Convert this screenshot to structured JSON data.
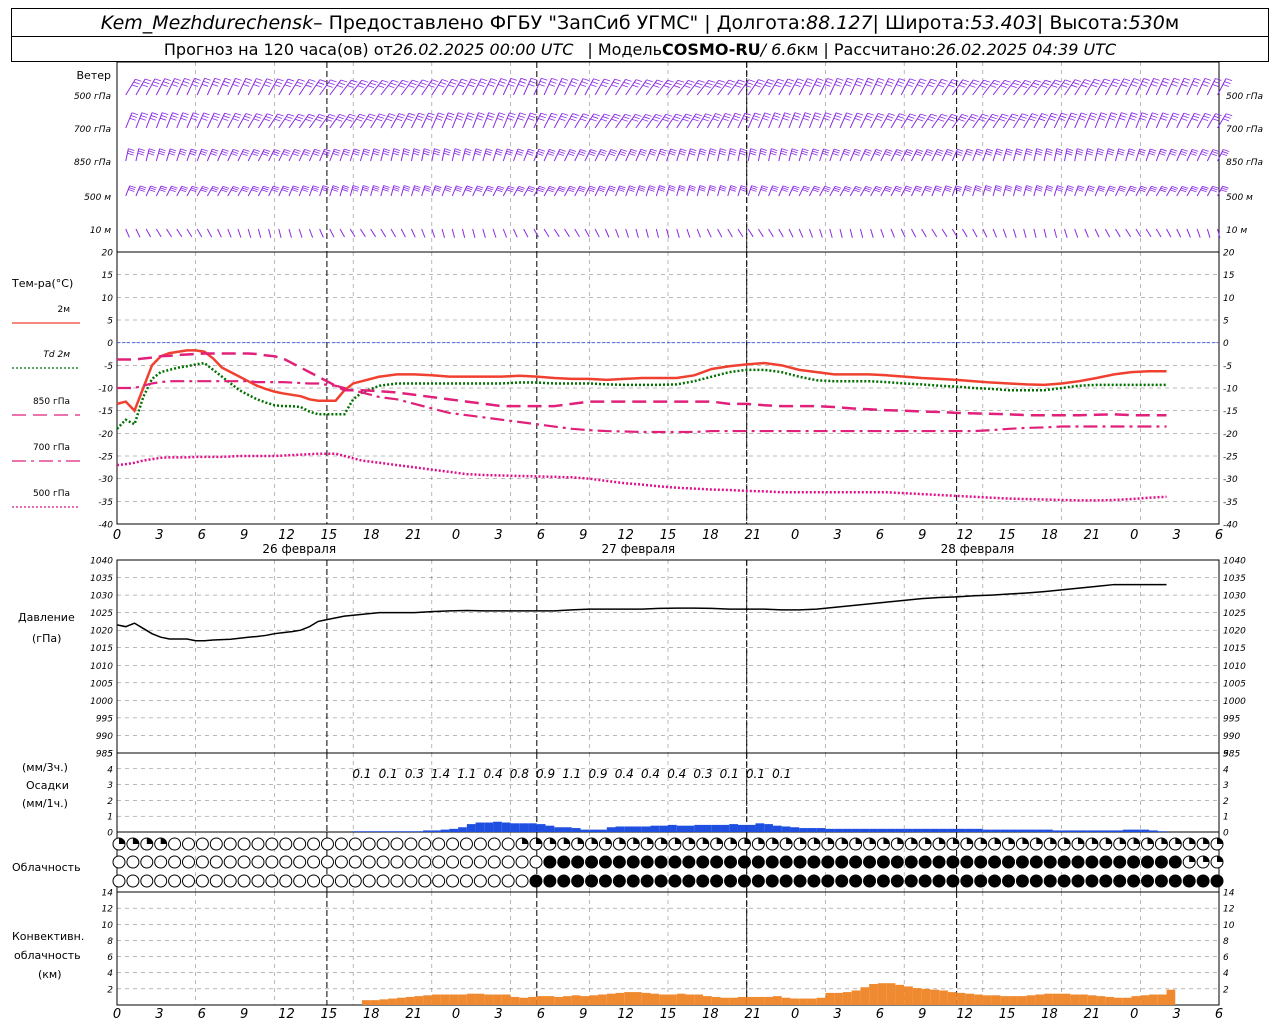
{
  "header": {
    "station": "Kem_Mezhdurechensk",
    "provider": " – Предоставлено ФГБУ \"ЗапСиб УГМС\" | Долгота: ",
    "lon": "88.127",
    "lat_label": " | Широта: ",
    "lat": "53.403",
    "alt_label": " | Высота: ",
    "alt": "530",
    "alt_unit": "м",
    "fc_label": "Прогноз на 120 часа(ов) от ",
    "fc_time": "26.02.2025 00:00 UTC",
    "model_label": "| Модель ",
    "model": "COSMO-RU",
    "res": " / 6.6",
    "res_unit": "км | Рассчитано: ",
    "calc_time": "26.02.2025 04:39 UTC"
  },
  "labels": {
    "wind": "Ветер",
    "levels": [
      "500 гПа",
      "700 гПа",
      "850 гПа",
      "500 м",
      "10  м"
    ],
    "temp_title": "Тем-ра(°С)",
    "temp_legend": [
      "2м",
      "Td  2м",
      "850 гПа",
      "700 гПа",
      "500 гПа"
    ],
    "pres_title": "Давление",
    "pres_unit": "(гПа)",
    "prec_unit1": "(мм/3ч.)",
    "prec_title": "Осадки",
    "prec_unit2": "(мм/1ч.)",
    "cloud_title": "Облачность",
    "conv_title1": "Конвективн.",
    "conv_title2": "облачность",
    "conv_unit": "(км)"
  },
  "x_ticks": [
    "0",
    "3",
    "6",
    "9",
    "12",
    "15",
    "18",
    "21",
    "0",
    "3",
    "6",
    "9",
    "12",
    "15",
    "18",
    "21",
    "0",
    "3",
    "6",
    "9",
    "12",
    "15",
    "18",
    "21",
    "0",
    "3",
    "6"
  ],
  "days": [
    "26 февраля",
    "27 февраля",
    "28 февраля"
  ],
  "colors": {
    "t2m": "#f04030",
    "td2m": "#007000",
    "t850": "#e0207a",
    "t700": "#e0207a",
    "t500": "#e0108a",
    "pressure": "#000000",
    "precip": "#1f4fe0",
    "conv": "#f08a30",
    "wind": "#8a2be2",
    "zero": "#3050e0"
  },
  "chart_data": [
    {
      "type": "line",
      "panel": "temperature",
      "ylabel": "Тем-ра(°С)",
      "ylim": [
        -40,
        20
      ],
      "x_hours": [
        0,
        1,
        2,
        3,
        4,
        5,
        6,
        7,
        8,
        9,
        10,
        11,
        12,
        13,
        14,
        15,
        16,
        17,
        18,
        19,
        20,
        21,
        22,
        23,
        24,
        25,
        26,
        27,
        28,
        30,
        32,
        34,
        36,
        38,
        40,
        42,
        44,
        46,
        48,
        50,
        52,
        54,
        56,
        58,
        60,
        62,
        64,
        66,
        68,
        70,
        72,
        74,
        76,
        78,
        80,
        82,
        84,
        86,
        88,
        90,
        92,
        94,
        96,
        98,
        100,
        102,
        104,
        106,
        108,
        110,
        112,
        114,
        116,
        118,
        120
      ],
      "series": [
        {
          "name": "2м",
          "values": [
            -13.5,
            -13,
            -15,
            -10,
            -5,
            -3,
            -2.3,
            -2,
            -1.7,
            -1.7,
            -2,
            -3.5,
            -5.5,
            -6.5,
            -7.5,
            -8.5,
            -9.5,
            -10.2,
            -10.8,
            -11.2,
            -11.5,
            -11.8,
            -12.5,
            -12.8,
            -12.8,
            -12.8,
            -10.5,
            -9,
            -8.5,
            -7.5,
            -7,
            -7,
            -7.2,
            -7.5,
            -7.5,
            -7.5,
            -7.5,
            -7.3,
            -7.5,
            -7.8,
            -8,
            -8,
            -8.2,
            -8,
            -7.8,
            -7.8,
            -7.8,
            -7.2,
            -5.8,
            -5.2,
            -4.8,
            -4.5,
            -5,
            -6,
            -6.5,
            -7,
            -7,
            -7,
            -7.2,
            -7.5,
            -7.8,
            -8,
            -8.2,
            -8.5,
            -8.8,
            -9,
            -9.2,
            -9.3,
            -9,
            -8.5,
            -7.8,
            -7,
            -6.5,
            -6.3,
            -6.3
          ]
        },
        {
          "name": "Td  2м",
          "values": [
            -19,
            -17,
            -18,
            -12,
            -8,
            -6.5,
            -6,
            -5.5,
            -5.2,
            -4.8,
            -4.5,
            -6,
            -7.5,
            -9,
            -10.5,
            -11.5,
            -12.5,
            -13.2,
            -13.8,
            -14,
            -14,
            -14.2,
            -15.2,
            -15.8,
            -15.8,
            -15.8,
            -15.8,
            -12.5,
            -11,
            -9.5,
            -9,
            -9,
            -9,
            -9,
            -9,
            -9,
            -9,
            -8.8,
            -8.8,
            -9,
            -9,
            -9,
            -9.2,
            -9.3,
            -9.3,
            -9.3,
            -9.2,
            -8.5,
            -7.5,
            -6.5,
            -6,
            -6,
            -6.5,
            -7.5,
            -8.3,
            -8.5,
            -8.5,
            -8.5,
            -8.7,
            -9,
            -9.2,
            -9.5,
            -9.7,
            -10,
            -10.2,
            -10.5,
            -10.5,
            -10.5,
            -10,
            -9.5,
            -9.3,
            -9.3,
            -9.3,
            -9.3,
            -9.3
          ]
        },
        {
          "name": "850 гПа",
          "values": [
            -3.7,
            -3.7,
            -3.7,
            -3.5,
            -3.3,
            -3,
            -2.9,
            -2.7,
            -2.6,
            -2.5,
            -2.4,
            -2.4,
            -2.4,
            -2.4,
            -2.4,
            -2.4,
            -2.5,
            -2.8,
            -3,
            -3.5,
            -4.5,
            -5.5,
            -6.5,
            -7.5,
            -8.5,
            -9.5,
            -10.5,
            -10.5,
            -10.5,
            -10.7,
            -11,
            -11.5,
            -12,
            -12.5,
            -13,
            -13.5,
            -14,
            -14,
            -14,
            -14,
            -13.5,
            -13,
            -13,
            -13,
            -13,
            -13,
            -13,
            -13,
            -13,
            -13.5,
            -13.5,
            -13.8,
            -14,
            -14,
            -14,
            -14.2,
            -14.5,
            -14.7,
            -14.9,
            -15,
            -15.2,
            -15.3,
            -15.5,
            -15.6,
            -15.7,
            -15.8,
            -16,
            -16,
            -16,
            -16,
            -15.9,
            -15.8,
            -16,
            -16,
            -16
          ]
        },
        {
          "name": "700 гПа",
          "values": [
            -10,
            -10,
            -10,
            -9.5,
            -9,
            -8.7,
            -8.5,
            -8.5,
            -8.5,
            -8.5,
            -8.5,
            -8.5,
            -8.5,
            -8.5,
            -8.5,
            -8.5,
            -8.7,
            -8.7,
            -8.7,
            -8.7,
            -8.8,
            -8.9,
            -9,
            -9,
            -9.3,
            -9.5,
            -10,
            -10.5,
            -11,
            -12,
            -12.5,
            -13.5,
            -14.5,
            -15.5,
            -16,
            -16.5,
            -17,
            -17.5,
            -18,
            -18.5,
            -19,
            -19.3,
            -19.5,
            -19.6,
            -19.7,
            -19.7,
            -19.7,
            -19.7,
            -19.5,
            -19.5,
            -19.5,
            -19.5,
            -19.5,
            -19.5,
            -19.5,
            -19.5,
            -19.5,
            -19.5,
            -19.5,
            -19.5,
            -19.5,
            -19.5,
            -19.5,
            -19.5,
            -19.3,
            -19,
            -18.8,
            -18.7,
            -18.5,
            -18.5,
            -18.5,
            -18.5,
            -18.5,
            -18.5,
            -18.5
          ]
        },
        {
          "name": "500 гПа",
          "values": [
            -27,
            -26.8,
            -26.5,
            -26,
            -25.7,
            -25.4,
            -25.3,
            -25.3,
            -25.3,
            -25.2,
            -25.2,
            -25.2,
            -25.2,
            -25.1,
            -25,
            -25,
            -25,
            -25,
            -25,
            -24.9,
            -24.8,
            -24.7,
            -24.6,
            -24.5,
            -24.5,
            -24.5,
            -25,
            -25.5,
            -26,
            -26.5,
            -27,
            -27.5,
            -28,
            -28.5,
            -29,
            -29.2,
            -29.3,
            -29.4,
            -29.5,
            -29.6,
            -29.7,
            -30,
            -30.5,
            -31,
            -31.3,
            -31.7,
            -32,
            -32.2,
            -32.4,
            -32.5,
            -32.7,
            -32.8,
            -33,
            -33,
            -33,
            -33,
            -33,
            -33,
            -33,
            -33.2,
            -33.4,
            -33.6,
            -33.8,
            -34,
            -34.2,
            -34.4,
            -34.5,
            -34.6,
            -34.7,
            -34.8,
            -34.8,
            -34.7,
            -34.5,
            -34.2,
            -34
          ]
        }
      ]
    },
    {
      "type": "line",
      "panel": "pressure",
      "ylabel": "Давление (гПа)",
      "ylim": [
        985,
        1040
      ],
      "x_hours": [
        0,
        1,
        2,
        3,
        4,
        5,
        6,
        7,
        8,
        9,
        10,
        11,
        12,
        13,
        14,
        15,
        16,
        17,
        18,
        19,
        20,
        21,
        22,
        23,
        24,
        26,
        28,
        30,
        32,
        34,
        36,
        38,
        40,
        42,
        44,
        46,
        48,
        50,
        52,
        54,
        56,
        58,
        60,
        62,
        64,
        66,
        68,
        70,
        72,
        74,
        76,
        78,
        80,
        82,
        84,
        86,
        88,
        90,
        92,
        94,
        96,
        98,
        100,
        102,
        104,
        106,
        108,
        110,
        112,
        114,
        116,
        118,
        120
      ],
      "series": [
        {
          "name": "Давление",
          "values": [
            1021.5,
            1021,
            1022,
            1020.5,
            1019,
            1018,
            1017.5,
            1017.5,
            1017.5,
            1017,
            1017,
            1017.2,
            1017.3,
            1017.4,
            1017.7,
            1018,
            1018.2,
            1018.5,
            1019,
            1019.3,
            1019.6,
            1020,
            1021,
            1022.5,
            1023,
            1024,
            1024.5,
            1025,
            1025,
            1025,
            1025.3,
            1025.5,
            1025.6,
            1025.5,
            1025.5,
            1025.5,
            1025.5,
            1025.5,
            1025.8,
            1026,
            1026,
            1026,
            1026,
            1026.2,
            1026.3,
            1026.3,
            1026.2,
            1026,
            1026,
            1026,
            1025.8,
            1025.8,
            1026,
            1026.5,
            1027,
            1027.5,
            1028,
            1028.5,
            1029,
            1029.3,
            1029.5,
            1029.8,
            1030,
            1030.3,
            1030.6,
            1031,
            1031.5,
            1032,
            1032.5,
            1033,
            1033,
            1033,
            1033
          ]
        }
      ]
    },
    {
      "type": "bar",
      "panel": "precipitation",
      "ylabel": "Осадки",
      "ylim": [
        0,
        5
      ],
      "totals_3h": [
        "0.1",
        "0.1",
        "0.3",
        "1.4",
        "1.1",
        "0.4",
        "0.8",
        "0.9",
        "1.1",
        "0.9",
        "0.4",
        "0.4",
        "0.4",
        "0.3",
        "0.1",
        "0.1",
        "0.1"
      ],
      "totals_hours": [
        28,
        31,
        34,
        37,
        40,
        43,
        46,
        49,
        52,
        55,
        58,
        61,
        64,
        67,
        70,
        73,
        76
      ],
      "x_hours": [
        27,
        28,
        29,
        30,
        31,
        32,
        33,
        34,
        35,
        36,
        37,
        38,
        39,
        40,
        41,
        42,
        43,
        44,
        45,
        46,
        47,
        48,
        49,
        50,
        51,
        52,
        53,
        54,
        55,
        56,
        57,
        58,
        59,
        60,
        61,
        62,
        63,
        64,
        65,
        66,
        67,
        68,
        69,
        70,
        71,
        72,
        73,
        74,
        75,
        76,
        77,
        78,
        79,
        80,
        81,
        82,
        83,
        84,
        85,
        86,
        87,
        88,
        89,
        90,
        91,
        92,
        93,
        94,
        95,
        96,
        97,
        98,
        99,
        100,
        101,
        102,
        103,
        104,
        105,
        106,
        107,
        108,
        109,
        110,
        111,
        112,
        113,
        114,
        115,
        116,
        117,
        118,
        119
      ],
      "values": [
        0.05,
        0.05,
        0.05,
        0.05,
        0.05,
        0.05,
        0.05,
        0.05,
        0.1,
        0.1,
        0.15,
        0.2,
        0.3,
        0.5,
        0.6,
        0.6,
        0.65,
        0.6,
        0.55,
        0.55,
        0.55,
        0.5,
        0.4,
        0.3,
        0.3,
        0.25,
        0.15,
        0.15,
        0.15,
        0.3,
        0.35,
        0.35,
        0.35,
        0.35,
        0.4,
        0.4,
        0.45,
        0.4,
        0.4,
        0.45,
        0.45,
        0.45,
        0.45,
        0.5,
        0.45,
        0.45,
        0.55,
        0.5,
        0.4,
        0.35,
        0.3,
        0.25,
        0.25,
        0.25,
        0.2,
        0.2,
        0.2,
        0.2,
        0.2,
        0.2,
        0.2,
        0.2,
        0.2,
        0.2,
        0.2,
        0.2,
        0.2,
        0.2,
        0.2,
        0.2,
        0.2,
        0.2,
        0.15,
        0.15,
        0.15,
        0.15,
        0.15,
        0.15,
        0.15,
        0.15,
        0.1,
        0.1,
        0.1,
        0.1,
        0.1,
        0.1,
        0.1,
        0.1,
        0.15,
        0.15,
        0.15,
        0.1,
        0.05
      ]
    },
    {
      "type": "bar",
      "panel": "convective_cloud",
      "ylabel": "Конвективн. облачность (км)",
      "ylim": [
        0,
        14
      ],
      "x_hours": [
        28,
        29,
        30,
        31,
        32,
        33,
        34,
        35,
        36,
        37,
        38,
        39,
        40,
        41,
        42,
        43,
        44,
        45,
        46,
        47,
        48,
        49,
        50,
        51,
        52,
        53,
        54,
        55,
        56,
        57,
        58,
        59,
        60,
        61,
        62,
        63,
        64,
        65,
        66,
        67,
        68,
        69,
        70,
        71,
        72,
        73,
        74,
        75,
        76,
        77,
        78,
        79,
        80,
        81,
        82,
        83,
        84,
        85,
        86,
        87,
        88,
        89,
        90,
        91,
        92,
        93,
        94,
        95,
        96,
        97,
        98,
        99,
        100,
        101,
        102,
        103,
        104,
        105,
        106,
        107,
        108,
        109,
        110,
        111,
        112,
        113,
        114,
        115,
        116,
        117,
        118,
        119,
        120
      ],
      "values": [
        0.6,
        0.6,
        0.7,
        0.8,
        0.9,
        1.0,
        1.1,
        1.2,
        1.3,
        1.3,
        1.3,
        1.3,
        1.4,
        1.4,
        1.3,
        1.3,
        1.3,
        1.0,
        0.9,
        1.0,
        1.1,
        1.1,
        1.0,
        1.1,
        1.2,
        1.1,
        1.2,
        1.3,
        1.4,
        1.5,
        1.6,
        1.6,
        1.5,
        1.4,
        1.3,
        1.3,
        1.4,
        1.3,
        1.3,
        1.1,
        1.0,
        0.9,
        0.9,
        1.0,
        1.0,
        1.0,
        1.0,
        1.1,
        0.9,
        0.8,
        0.8,
        0.8,
        0.9,
        1.5,
        1.5,
        1.6,
        1.8,
        2.2,
        2.6,
        2.7,
        2.7,
        2.5,
        2.3,
        2.1,
        2.0,
        1.9,
        1.8,
        1.6,
        1.5,
        1.4,
        1.3,
        1.2,
        1.2,
        1.1,
        1.1,
        1.1,
        1.2,
        1.3,
        1.4,
        1.4,
        1.4,
        1.3,
        1.3,
        1.2,
        1.1,
        1.0,
        0.9,
        0.9,
        1.1,
        1.2,
        1.3,
        1.3,
        1.9
      ]
    }
  ],
  "clouds": {
    "row1_codes": "bbbbbbbaaaaaaaaaaaaaaaaaaaaaaaaaaaaaaaaaaaaaaaaaaaaaaaacbbbbbbbbbbbbbbbbbbbbbbbbbbbbbbbbbbbbbbbbbbbbbbbbbbbbbbbbbbbbbbbbbbbbbbbbbbbbbbbbbbbbbbbbbbbbbbbbbbbb",
    "row2_codes": "aaaaaaaaaaaaaaaaaaaaaaaaaaaaaaaaaaaaaaaaaaaaaaaaaaaaaaaaaaddddddddddddddddddddddddddddddddddddddddddddddddddddddddddddddddddddddddddddddddddddddddddbbbbbb",
    "row3_codes": "aaaaaaaaaaaaaaaaaaaaaaaaaaaaaaaaaaaaaaaaaaaaaaaaaaaaaaaaadddddddddddddddddddddddddddddddddddddddddddddddddddddddddddddddddddddddddddddddddddddddddddddddd"
  }
}
